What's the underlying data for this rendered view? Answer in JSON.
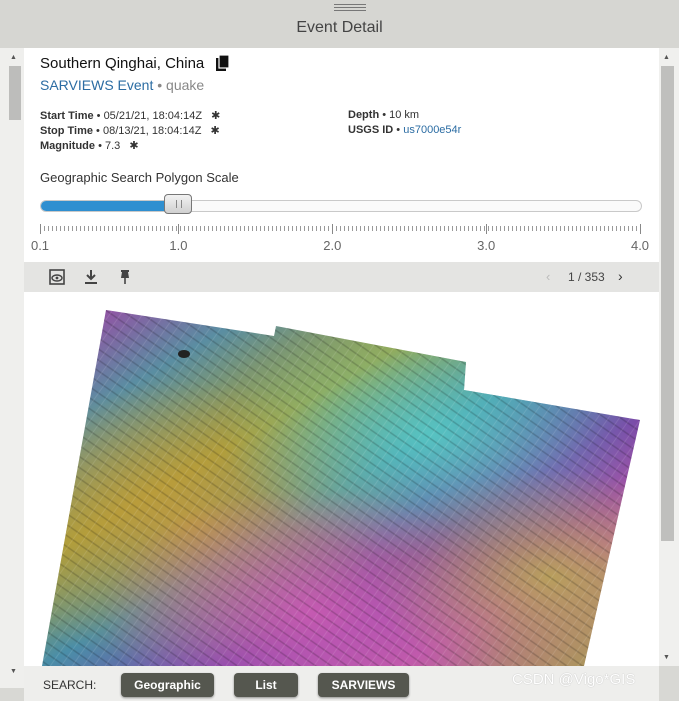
{
  "header": {
    "title": "Event Detail"
  },
  "event": {
    "name": "Southern Qinghai, China",
    "type_link": "SARVIEWS Event",
    "separator": "•",
    "category": "quake",
    "start_time_label": "Start Time",
    "start_time_value": "• 05/21/21, 18:04:14Z",
    "stop_time_label": "Stop Time",
    "stop_time_value": "• 08/13/21, 18:04:14Z",
    "magnitude_label": "Magnitude",
    "magnitude_value": "• 7.3",
    "depth_label": "Depth",
    "depth_value": "• 10 km",
    "usgs_label": "USGS ID",
    "usgs_sep": "• ",
    "usgs_value": "us7000e54r"
  },
  "scale": {
    "label": "Geographic Search Polygon Scale",
    "value": 1.0,
    "min": 0.1,
    "max": 4.0,
    "tick_labels": [
      "0.1",
      "1.0",
      "2.0",
      "3.0",
      "4.0"
    ]
  },
  "toolbar": {
    "icons": [
      "preview-icon",
      "download-icon",
      "pin-icon"
    ],
    "pager_text": "1 / 353"
  },
  "bottom": {
    "search_label": "SEARCH:",
    "buttons": [
      "Geographic",
      "List",
      "SARVIEWS"
    ]
  },
  "watermark": "CSDN @Vigo*GIS",
  "colors": {
    "link": "#2b6ca3",
    "slider_fill": "#2f8fd0",
    "button": "#55574f"
  }
}
